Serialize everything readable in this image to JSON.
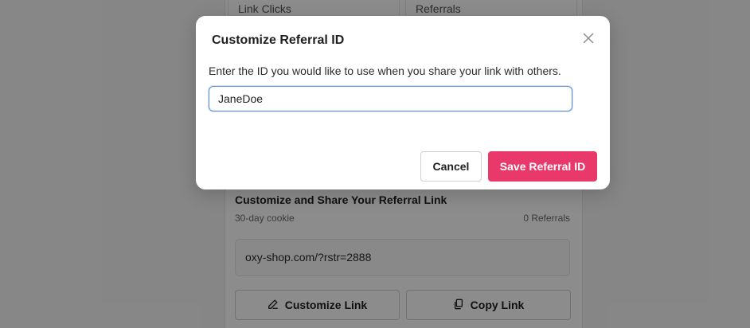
{
  "background": {
    "stats": [
      {
        "label": "Link Clicks"
      },
      {
        "label": "Referrals"
      }
    ],
    "share_section": {
      "title": "Customize and Share Your Referral Link",
      "cookie": "30-day cookie",
      "referrals_count": "0 Referrals",
      "link": "oxy-shop.com/?rstr=2888",
      "customize_label": "Customize Link",
      "copy_label": "Copy Link"
    }
  },
  "modal": {
    "title": "Customize Referral ID",
    "description": "Enter the ID you would like to use when you share your link with others.",
    "input_value": "JaneDoe",
    "cancel_label": "Cancel",
    "save_label": "Save Referral ID"
  },
  "colors": {
    "accent": "#e8396a",
    "input_focus": "#5b8fd9"
  },
  "icons": {
    "close": "close-icon",
    "edit": "pencil-icon",
    "copy": "copy-icon"
  }
}
